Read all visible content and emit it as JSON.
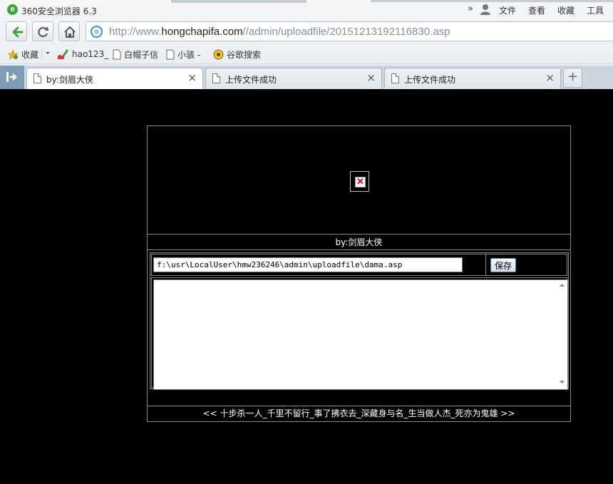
{
  "browser": {
    "title": "360安全浏览器 6.3",
    "menus": [
      "文件",
      "查看",
      "收藏",
      "工具"
    ],
    "url_prefix": "http://www.",
    "url_domain": "hongchapifa.com",
    "url_path": "//admin/uploadfile/20151213192116830.asp"
  },
  "bookmarks": [
    {
      "label": "收藏"
    },
    {
      "label": "hao123_"
    },
    {
      "label": "白帽子信"
    },
    {
      "label": "小骇 -"
    },
    {
      "label": "谷歌搜索"
    }
  ],
  "tabs": [
    {
      "label": "by:剑眉大侠",
      "close": "×"
    },
    {
      "label": "上传文件成功",
      "close": "×"
    },
    {
      "label": "上传文件成功",
      "close": "×"
    }
  ],
  "newtab_label": "+",
  "page": {
    "byline": "by:剑眉大侠",
    "path_value": "f:\\usr\\LocalUser\\hmw236246\\admin\\uploadfile\\dama.asp",
    "save_label": "保存",
    "content_value": "",
    "footer": "<< 十步杀一人_千里不留行_事了拂衣去_深藏身与名_生当做人杰_死亦为鬼雄 >>"
  },
  "colors": {
    "page_bg": "#000000",
    "border": "#8a8a8a",
    "accent": "#3d8fd8"
  }
}
